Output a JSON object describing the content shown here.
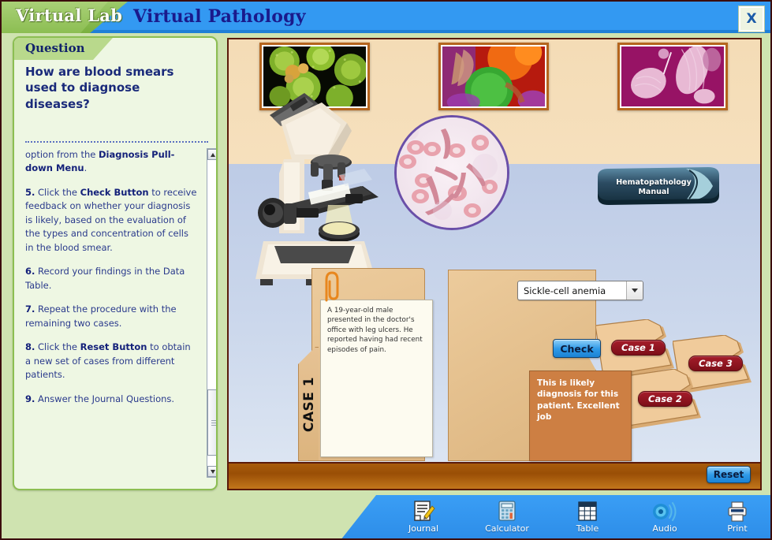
{
  "titlebar": {
    "brand": "Virtual Lab",
    "title": "Virtual Pathology",
    "close_label": "X"
  },
  "question_panel": {
    "header": "Question",
    "title": "How are blood smears used to diagnose diseases?",
    "steps": [
      {
        "html": "option from the <b>Diagnosis Pull-down Menu</b>."
      },
      {
        "html": "<b>5.</b> Click the <b>Check Button</b> to receive feedback on whether your diagnosis is likely, based on the evaluation of the types and concentration of cells in the blood smear."
      },
      {
        "html": "<b>6.</b> Record your findings in the Data Table."
      },
      {
        "html": "<b>7.</b> Repeat the procedure with the remaining two cases."
      },
      {
        "html": "<b>8.</b> Click the <b>Reset Button</b> to obtain a new set of cases from different patients."
      },
      {
        "html": "<b>9.</b> Answer the Journal Questions."
      }
    ],
    "scrollbar": {
      "up_icon": "triangle-up-icon",
      "down_icon": "triangle-down-icon"
    }
  },
  "stage": {
    "wall_images": [
      {
        "name": "pollen-micrograph",
        "alt": "green spiky pollen grains micrograph"
      },
      {
        "name": "cell-micrograph",
        "alt": "orange and green cell micrograph"
      },
      {
        "name": "tissue-micrograph",
        "alt": "magenta tissue micrograph"
      }
    ],
    "microscope_label": "microscope",
    "smear_label": "blood-smear-view",
    "book": {
      "line1": "Hematopathology",
      "line2": "Manual"
    },
    "case_folder": {
      "tab_label": "CASE 1",
      "patient_note": "A 19-year-old male presented in the doctor's office with leg ulcers. He reported having had recent episodes of pain.",
      "diagnosis_value": "Sickle-cell anemia",
      "check_label": "Check",
      "feedback": "This is likely diagnosis for this patient. Excellent job"
    },
    "case_tabs": [
      {
        "label": "Case 1"
      },
      {
        "label": "Case 3"
      },
      {
        "label": "Case 2"
      }
    ],
    "reset_label": "Reset"
  },
  "toolbar": {
    "items": [
      {
        "label": "Journal",
        "icon": "journal-icon"
      },
      {
        "label": "Calculator",
        "icon": "calculator-icon"
      },
      {
        "label": "Table",
        "icon": "table-icon"
      },
      {
        "label": "Audio",
        "icon": "audio-icon"
      },
      {
        "label": "Print",
        "icon": "print-icon"
      }
    ]
  },
  "colors": {
    "brand_green": "#8cbe52",
    "title_blue": "#3399f2",
    "panel_bg": "#eef7e3",
    "text_navy": "#1a2a7a",
    "desk_brown": "#a85c0c",
    "feedback_orange": "#cd7f43",
    "case_pill_red": "#a51d2b"
  }
}
